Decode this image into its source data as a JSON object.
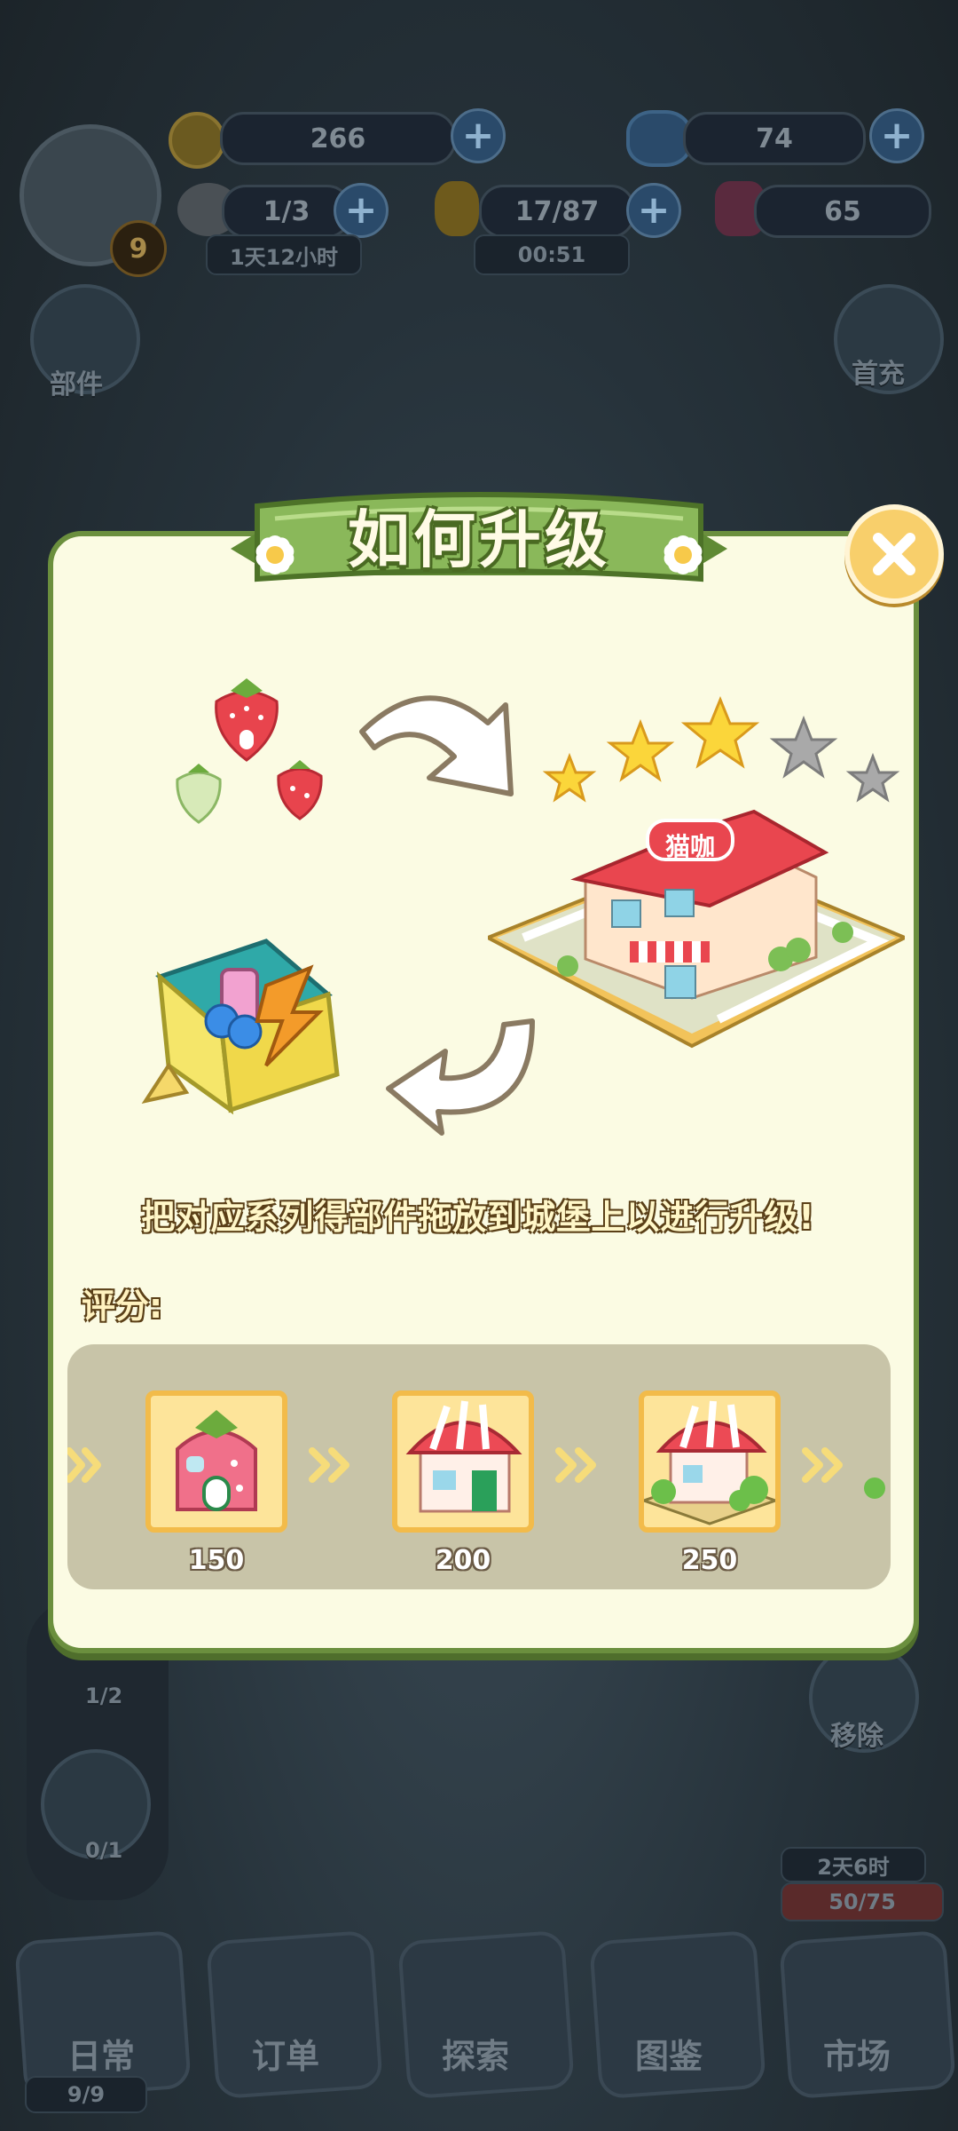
{
  "hud": {
    "coins": "266",
    "gems": "74",
    "cats": "1/3",
    "cats_timer": "1天12小时",
    "energy": "17/87",
    "energy_timer": "00:51",
    "stars": "65",
    "level": "9"
  },
  "sidebar": {
    "mail_label": "部件",
    "first_recharge_label": "首充",
    "remove_label": "移除",
    "left_counter_1": "1/2",
    "left_counter_2": "0/1",
    "event_timer": "2天6时",
    "event_progress": "50/75"
  },
  "bottom_nav": {
    "items": [
      {
        "label": "日常",
        "badge": "9/9"
      },
      {
        "label": "订单"
      },
      {
        "label": "探索"
      },
      {
        "label": "图鉴"
      },
      {
        "label": "市场"
      }
    ]
  },
  "dialog": {
    "title": "如何升级",
    "instruction": "把对应系列得部件拖放到城堡上以进行升级!",
    "rating_label": "评分:",
    "building_sign": "猫咖",
    "star_rating": {
      "filled": 3,
      "total": 5
    },
    "stages": [
      {
        "name": "strawberry-house",
        "score": "150"
      },
      {
        "name": "striped-awning-shop",
        "score": "200"
      },
      {
        "name": "garden-shop",
        "score": "250"
      }
    ]
  },
  "colors": {
    "dialog_bg": "#fbfbe3",
    "dialog_border": "#6b8f3e",
    "banner_green": "#7aa84a",
    "tile_bg": "#fde49a",
    "tile_border": "#f2bb4a",
    "track_bg": "#c8c4a8",
    "close_button": "#f8cf6b"
  }
}
